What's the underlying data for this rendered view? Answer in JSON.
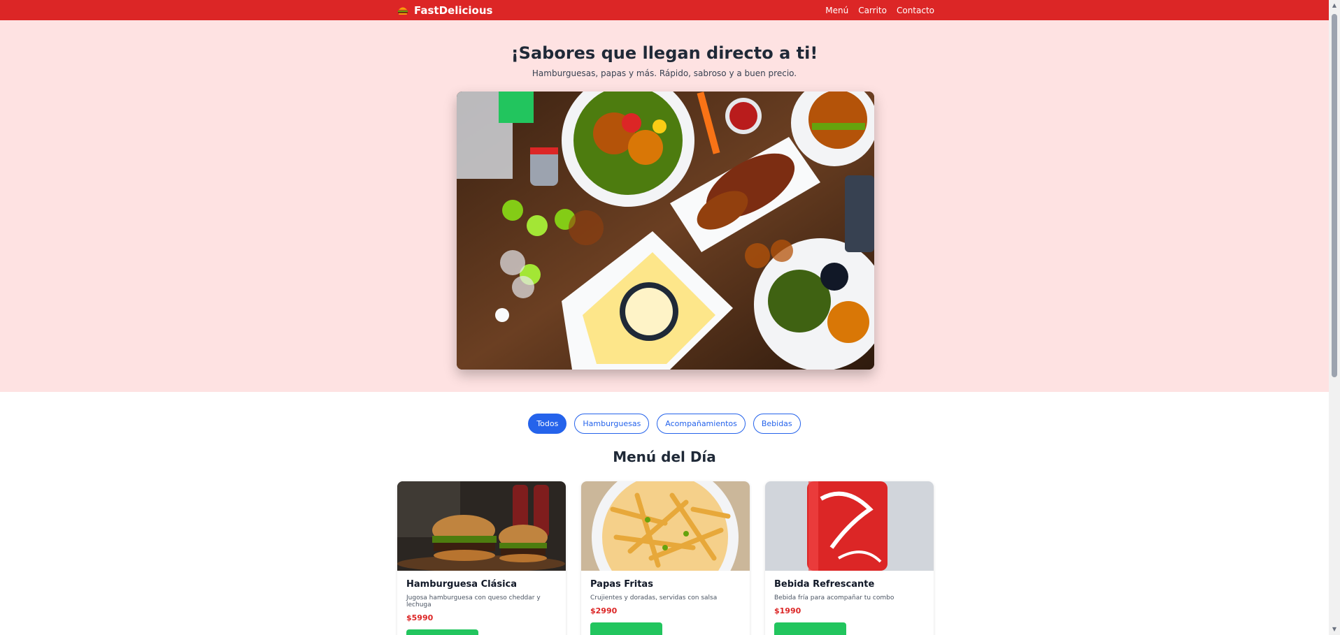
{
  "nav": {
    "brand_icon": "burger-icon",
    "brand": "FastDelicious",
    "links": [
      "Menú",
      "Carrito",
      "Contacto"
    ]
  },
  "hero": {
    "title": "¡Sabores que llegan directo a ti!",
    "subtitle": "Hamburguesas, papas y más. Rápido, sabroso y a buen precio."
  },
  "filters": {
    "chips": [
      "Todos",
      "Hamburguesas",
      "Acompañamientos",
      "Bebidas"
    ],
    "active": "Todos"
  },
  "menu": {
    "title": "Menú del Día",
    "items": [
      {
        "name": "Hamburguesa Clásica",
        "desc": "Jugosa hamburguesa con queso cheddar y lechuga",
        "price": "$5990"
      },
      {
        "name": "Papas Fritas",
        "desc": "Crujientes y doradas, servidas con salsa",
        "price": "$2990"
      },
      {
        "name": "Bebida Refrescante",
        "desc": "Bebida fría para acompañar tu combo",
        "price": "$1990"
      }
    ]
  },
  "colors": {
    "nav": "#dc2626",
    "hero_bg": "#fee2e2",
    "accent_blue": "#2563eb",
    "price_red": "#dc2626",
    "button_green": "#22c55e"
  }
}
